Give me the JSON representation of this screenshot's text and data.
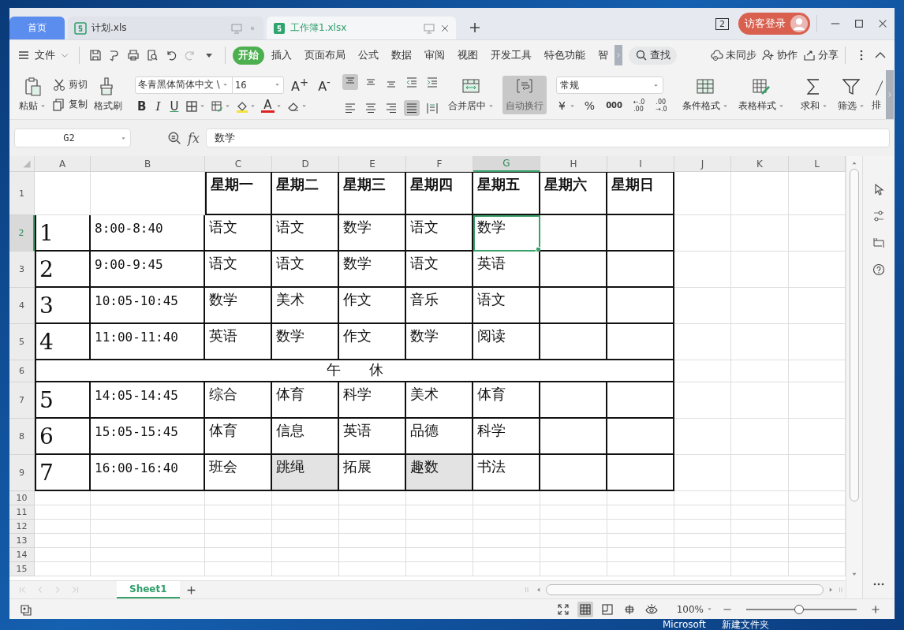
{
  "desktop": {
    "labels": [
      "Microsoft",
      "新建文件夹"
    ]
  },
  "doc_tabs": [
    {
      "label": "首页",
      "kind": "home",
      "selected": false
    },
    {
      "label": "计划.xls",
      "kind": "file",
      "selected": false
    },
    {
      "label": "工作簿1.xlsx",
      "kind": "file",
      "selected": true
    }
  ],
  "title_bar": {
    "window_count": "2",
    "login": "访客登录"
  },
  "menu": {
    "file": "文件",
    "tabs": [
      {
        "label": "开始",
        "selected": true
      },
      {
        "label": "插入",
        "selected": false
      },
      {
        "label": "页面布局",
        "selected": false
      },
      {
        "label": "公式",
        "selected": false
      },
      {
        "label": "数据",
        "selected": false
      },
      {
        "label": "审阅",
        "selected": false
      },
      {
        "label": "视图",
        "selected": false
      },
      {
        "label": "开发工具",
        "selected": false
      },
      {
        "label": "特色功能",
        "selected": false
      },
      {
        "label": "智",
        "selected": false
      }
    ],
    "search": "查找",
    "actions": [
      "未同步",
      "协作",
      "分享"
    ]
  },
  "ribbon": {
    "paste": "粘贴",
    "cut": "剪切",
    "copy": "复制",
    "format_painter": "格式刷",
    "font_name": "冬青黑体简体中文 \\",
    "font_size": "16",
    "grow_font": "A$^{+}$",
    "shrink_font": "A$^{-}$",
    "bold": "B",
    "italic": "I",
    "underline": "U",
    "font_color": "A",
    "merge": "合并居中",
    "wrap": {
      "label": "自动换行",
      "on": true
    },
    "number_format": "常规",
    "currency": "¥",
    "percent": "%",
    "thousands": "000",
    "add_decimal": [
      "←.0",
      ".00"
    ],
    "remove_decimal": [
      ".00",
      "→.0"
    ],
    "conditional": "条件格式",
    "table_style": "表格样式",
    "sum": "求和",
    "filter": "筛选",
    "sort": "排"
  },
  "formula_bar": {
    "name_box": "G2",
    "fx": "fx",
    "formula": "数学"
  },
  "sheet": {
    "columns": [
      {
        "label": "A",
        "selected": false
      },
      {
        "label": "B",
        "selected": false
      },
      {
        "label": "C",
        "selected": false
      },
      {
        "label": "D",
        "selected": false
      },
      {
        "label": "E",
        "selected": false
      },
      {
        "label": "F",
        "selected": false
      },
      {
        "label": "G",
        "selected": true
      },
      {
        "label": "H",
        "selected": false
      },
      {
        "label": "I",
        "selected": false
      },
      {
        "label": "J",
        "selected": false
      },
      {
        "label": "K",
        "selected": false
      },
      {
        "label": "L",
        "selected": false
      }
    ],
    "rows": [
      {
        "number": "1",
        "kind": "header",
        "selected": false,
        "cells": [
          {
            "shaded": false,
            "selected": false
          },
          {
            "shaded": false,
            "selected": false
          },
          {
            "text": "星期一",
            "shaded": false,
            "selected": false
          },
          {
            "text": "星期二",
            "shaded": false,
            "selected": false
          },
          {
            "text": "星期三",
            "shaded": false,
            "selected": false
          },
          {
            "text": "星期四",
            "shaded": false,
            "selected": false
          },
          {
            "text": "星期五",
            "shaded": false,
            "selected": false
          },
          {
            "text": "星期六",
            "shaded": false,
            "selected": false
          },
          {
            "text": "星期日",
            "shaded": false,
            "selected": false
          }
        ]
      },
      {
        "number": "2",
        "kind": "lesson",
        "selected": true,
        "cells": [
          {
            "text": "1",
            "shaded": false,
            "selected": false
          },
          {
            "text": "8:00-8:40",
            "shaded": false,
            "selected": false
          },
          {
            "text": "语文",
            "shaded": false,
            "selected": false
          },
          {
            "text": "语文",
            "shaded": false,
            "selected": false
          },
          {
            "text": "数学",
            "shaded": false,
            "selected": false
          },
          {
            "text": "语文",
            "shaded": false,
            "selected": false
          },
          {
            "text": "数学",
            "shaded": false,
            "selected": true
          },
          {
            "shaded": false,
            "selected": false
          },
          {
            "shaded": false,
            "selected": false
          }
        ]
      },
      {
        "number": "3",
        "kind": "lesson",
        "selected": false,
        "cells": [
          {
            "text": "2",
            "shaded": false,
            "selected": false
          },
          {
            "text": "9:00-9:45",
            "shaded": false,
            "selected": false
          },
          {
            "text": "语文",
            "shaded": false,
            "selected": false
          },
          {
            "text": "语文",
            "shaded": false,
            "selected": false
          },
          {
            "text": "数学",
            "shaded": false,
            "selected": false
          },
          {
            "text": "语文",
            "shaded": false,
            "selected": false
          },
          {
            "text": "英语",
            "shaded": false,
            "selected": false
          },
          {
            "shaded": false,
            "selected": false
          },
          {
            "shaded": false,
            "selected": false
          }
        ]
      },
      {
        "number": "4",
        "kind": "lesson",
        "selected": false,
        "cells": [
          {
            "text": "3",
            "shaded": false,
            "selected": false
          },
          {
            "text": "10:05-10:45",
            "shaded": false,
            "selected": false
          },
          {
            "text": "数学",
            "shaded": false,
            "selected": false
          },
          {
            "text": "美术",
            "shaded": false,
            "selected": false
          },
          {
            "text": "作文",
            "shaded": false,
            "selected": false
          },
          {
            "text": "音乐",
            "shaded": false,
            "selected": false
          },
          {
            "text": "语文",
            "shaded": false,
            "selected": false
          },
          {
            "shaded": false,
            "selected": false
          },
          {
            "shaded": false,
            "selected": false
          }
        ]
      },
      {
        "number": "5",
        "kind": "lesson",
        "selected": false,
        "cells": [
          {
            "text": "4",
            "shaded": false,
            "selected": false
          },
          {
            "text": "11:00-11:40",
            "shaded": false,
            "selected": false
          },
          {
            "text": "英语",
            "shaded": false,
            "selected": false
          },
          {
            "text": "数学",
            "shaded": false,
            "selected": false
          },
          {
            "text": "作文",
            "shaded": false,
            "selected": false
          },
          {
            "text": "数学",
            "shaded": false,
            "selected": false
          },
          {
            "text": "阅读",
            "shaded": false,
            "selected": false
          },
          {
            "shaded": false,
            "selected": false
          },
          {
            "shaded": false,
            "selected": false
          }
        ]
      },
      {
        "number": "6",
        "kind": "break",
        "selected": false,
        "cells": [
          {
            "text": "午　　休",
            "shaded": false,
            "selected": false
          }
        ]
      },
      {
        "number": "7",
        "kind": "lesson",
        "selected": false,
        "cells": [
          {
            "text": "5",
            "shaded": false,
            "selected": false
          },
          {
            "text": "14:05-14:45",
            "shaded": false,
            "selected": false
          },
          {
            "text": "综合",
            "shaded": false,
            "selected": false
          },
          {
            "text": "体育",
            "shaded": false,
            "selected": false
          },
          {
            "text": "科学",
            "shaded": false,
            "selected": false
          },
          {
            "text": "美术",
            "shaded": false,
            "selected": false
          },
          {
            "text": "体育",
            "shaded": false,
            "selected": false
          },
          {
            "shaded": false,
            "selected": false
          },
          {
            "shaded": false,
            "selected": false
          }
        ]
      },
      {
        "number": "8",
        "kind": "lesson",
        "selected": false,
        "cells": [
          {
            "text": "6",
            "shaded": false,
            "selected": false
          },
          {
            "text": "15:05-15:45",
            "shaded": false,
            "selected": false
          },
          {
            "text": "体育",
            "shaded": false,
            "selected": false
          },
          {
            "text": "信息",
            "shaded": false,
            "selected": false
          },
          {
            "text": "英语",
            "shaded": false,
            "selected": false
          },
          {
            "text": "品德",
            "shaded": false,
            "selected": false
          },
          {
            "text": "科学",
            "shaded": false,
            "selected": false
          },
          {
            "shaded": false,
            "selected": false
          },
          {
            "shaded": false,
            "selected": false
          }
        ]
      },
      {
        "number": "9",
        "kind": "lesson",
        "selected": false,
        "cells": [
          {
            "text": "7",
            "shaded": false,
            "selected": false
          },
          {
            "text": "16:00-16:40",
            "shaded": false,
            "selected": false
          },
          {
            "text": "班会",
            "shaded": false,
            "selected": false
          },
          {
            "text": "跳绳",
            "shaded": true,
            "selected": false
          },
          {
            "text": "拓展",
            "shaded": false,
            "selected": false
          },
          {
            "text": "趣数",
            "shaded": true,
            "selected": false
          },
          {
            "text": "书法",
            "shaded": false,
            "selected": false
          },
          {
            "shaded": false,
            "selected": false
          },
          {
            "shaded": false,
            "selected": false
          }
        ]
      },
      {
        "number": "10",
        "kind": "blank",
        "selected": false
      },
      {
        "number": "11",
        "kind": "blank",
        "selected": false
      },
      {
        "number": "12",
        "kind": "blank",
        "selected": false
      },
      {
        "number": "13",
        "kind": "blank",
        "selected": false
      },
      {
        "number": "14",
        "kind": "blank",
        "selected": false
      },
      {
        "number": "15",
        "kind": "blank",
        "selected": false
      }
    ]
  },
  "sheet_tabs": [
    {
      "label": "Sheet1",
      "selected": true
    }
  ],
  "status_bar": {
    "zoom": "100%",
    "zoom_slider": {
      "level": 0.48
    },
    "views": [
      {
        "kind": "fullscreen",
        "selected": false
      },
      {
        "kind": "normal",
        "selected": true
      },
      {
        "kind": "page",
        "selected": false
      },
      {
        "kind": "pagebreak",
        "selected": false
      },
      {
        "kind": "eye",
        "selected": false
      }
    ]
  }
}
